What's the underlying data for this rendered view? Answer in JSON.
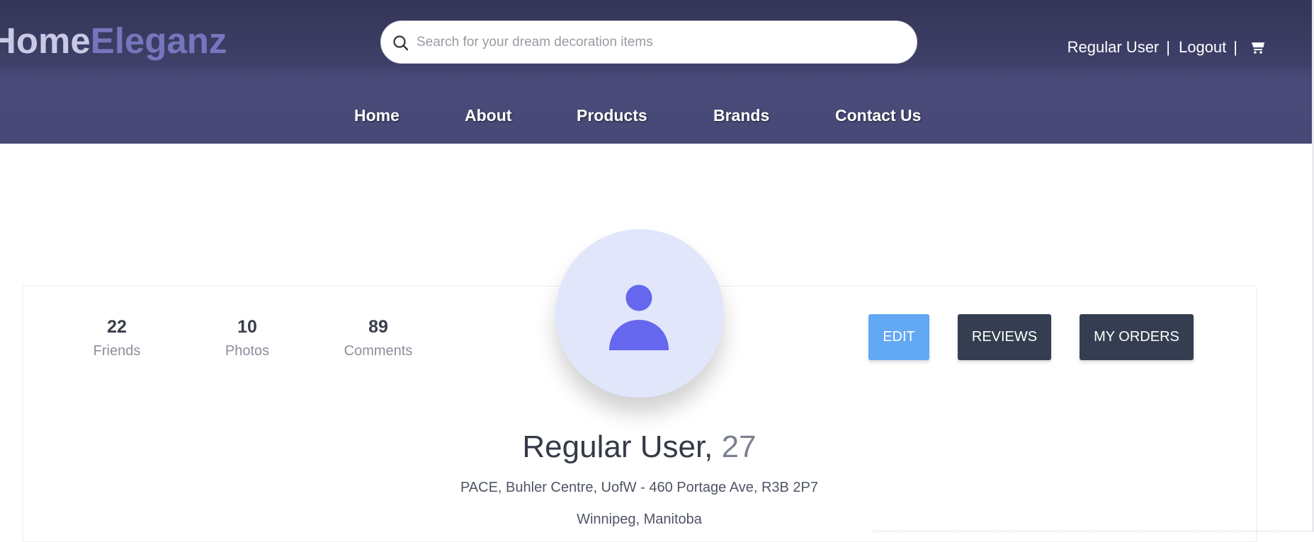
{
  "header": {
    "logo_part1": "Home",
    "logo_part2": "Eleganz",
    "search_placeholder": "Search for your dream decoration items",
    "user_name": "Regular User",
    "separator": "|",
    "logout_label": "Logout",
    "cart_icon": "cart-icon"
  },
  "nav": {
    "items": [
      {
        "label": "Home"
      },
      {
        "label": "About"
      },
      {
        "label": "Products"
      },
      {
        "label": "Brands"
      },
      {
        "label": "Contact Us"
      }
    ]
  },
  "profile": {
    "stats": [
      {
        "value": "22",
        "label": "Friends"
      },
      {
        "value": "10",
        "label": "Photos"
      },
      {
        "value": "89",
        "label": "Comments"
      }
    ],
    "avatar_icon": "user-icon",
    "buttons": {
      "edit": "EDIT",
      "reviews": "REVIEWS",
      "orders": "MY ORDERS"
    },
    "name": "Regular User,",
    "age": "27",
    "address": "PACE, Buhler Centre, UofW - 460 Portage Ave, R3B 2P7",
    "city": "Winnipeg, Manitoba"
  },
  "colors": {
    "header_bg": "#3f4069",
    "logo_accent": "#7576bd",
    "edit_button": "#63a8f3",
    "dark_button": "#343e50",
    "avatar_bg": "#e1e6fb",
    "avatar_icon": "#6567ee"
  }
}
